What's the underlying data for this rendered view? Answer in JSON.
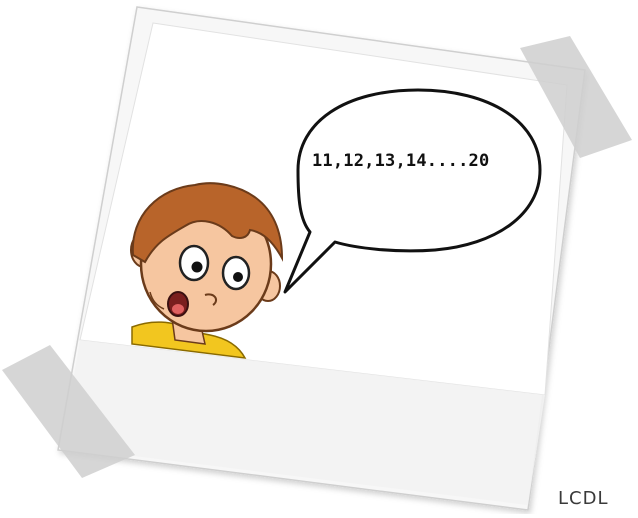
{
  "speech_bubble": {
    "text": "11,12,13,14....20"
  },
  "credit": {
    "text": "LCDL"
  },
  "colors": {
    "hair": "#b8642a",
    "skin": "#f6c6a0",
    "shirt": "#f2c61f",
    "tape": "#cfcfcf",
    "photo_frame": "#fafafa"
  }
}
